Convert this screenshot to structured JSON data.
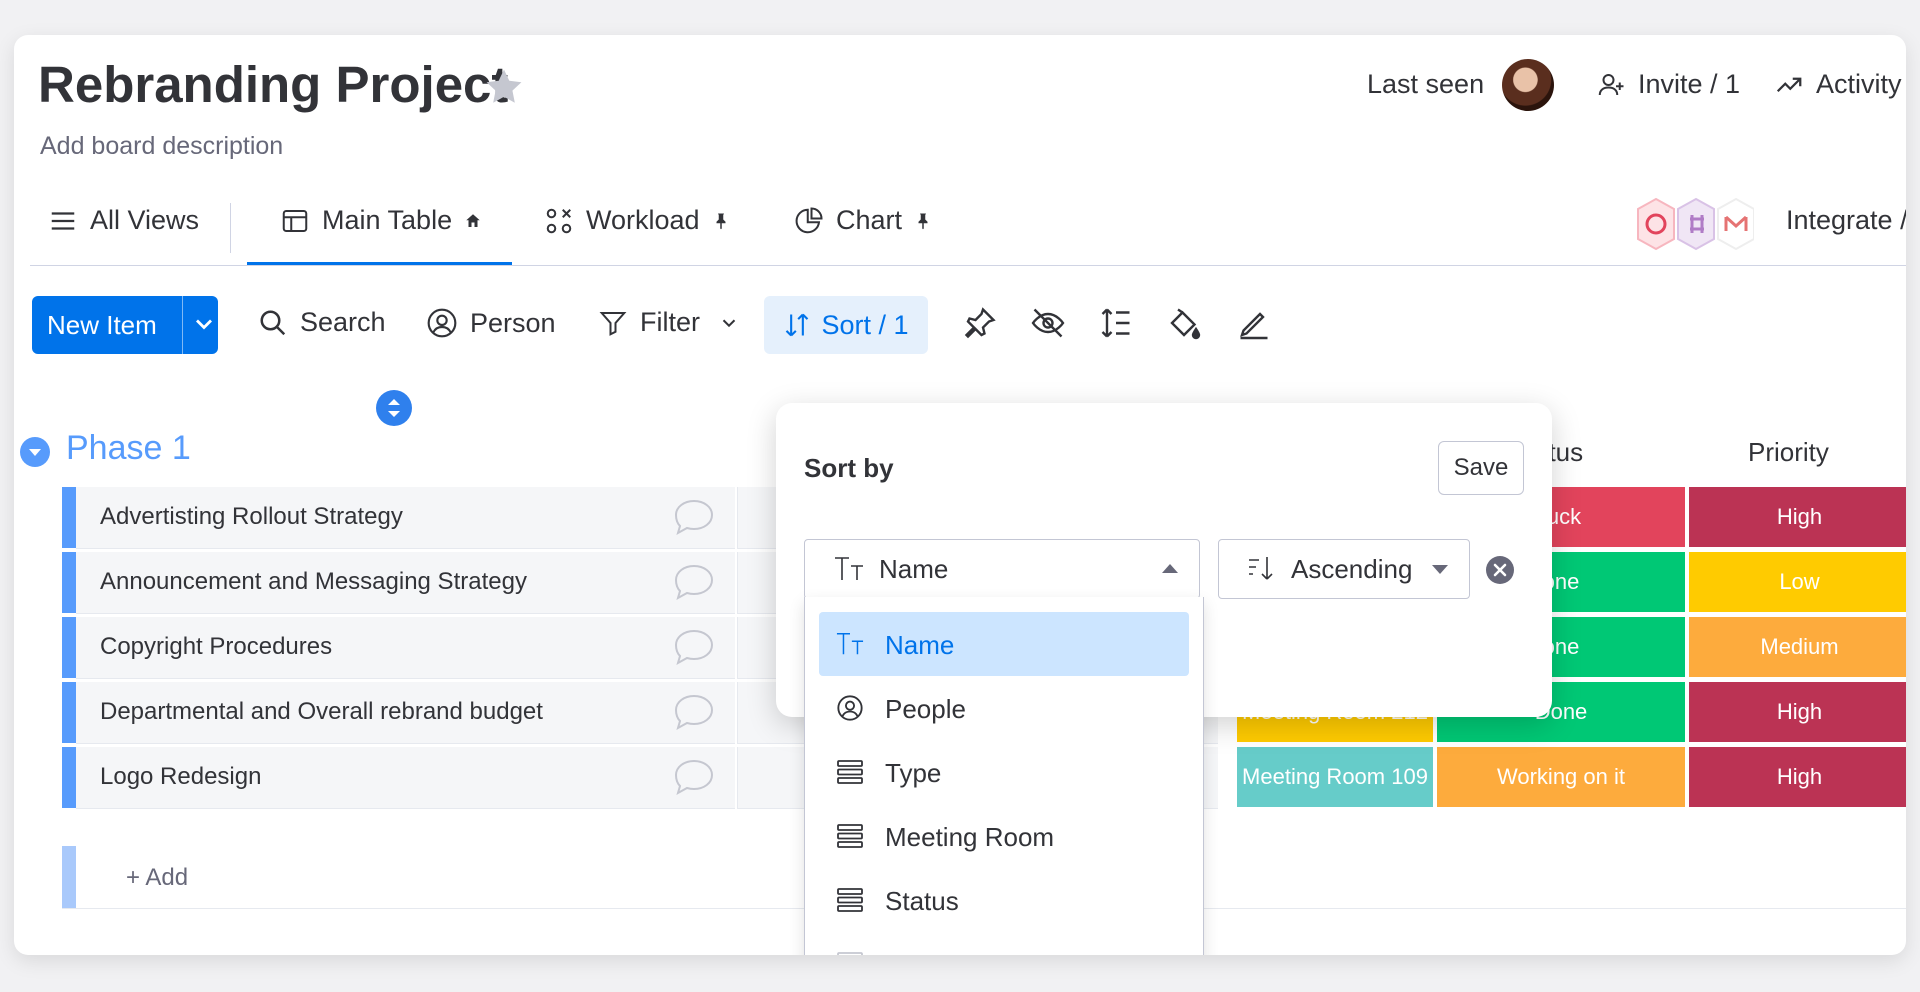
{
  "board": {
    "title": "Rebranding Project",
    "description": "Add board description"
  },
  "header": {
    "last_seen": "Last seen",
    "invite": "Invite / 1",
    "activity": "Activity"
  },
  "views": {
    "all_views": "All Views",
    "tabs": [
      {
        "label": "Main Table",
        "icon": "table-icon",
        "badge": "home-icon",
        "active": true
      },
      {
        "label": "Workload",
        "icon": "workload-icon",
        "badge": "pin-icon"
      },
      {
        "label": "Chart",
        "icon": "pie-chart-icon",
        "badge": "pin-icon"
      }
    ],
    "integrate": "Integrate /"
  },
  "toolbar": {
    "new_item": "New Item",
    "search": "Search",
    "person": "Person",
    "filter": "Filter",
    "sort": "Sort / 1",
    "icons": [
      "pin-icon",
      "hide-icon",
      "row-height-icon",
      "color-icon",
      "edit-icon"
    ]
  },
  "group": {
    "title": "Phase 1",
    "columns": {
      "status": "atus",
      "priority": "Priority"
    },
    "rows": [
      {
        "name": "Advertisting Rollout Strategy",
        "room": "",
        "status": "tuck",
        "priority": "High"
      },
      {
        "name": "Announcement and Messaging Strategy",
        "room": "",
        "status": "one",
        "priority": "Low"
      },
      {
        "name": "Copyright Procedures",
        "room": "",
        "status": "one",
        "priority": "Medium"
      },
      {
        "name": "Departmental and Overall rebrand budget",
        "room": "Meeting Room 212",
        "status": "Done",
        "priority": "High"
      },
      {
        "name": "Logo Redesign",
        "room": "Meeting Room 109",
        "status": "Working on it",
        "priority": "High"
      }
    ],
    "add_label": "+ Add"
  },
  "sort_popover": {
    "title": "Sort by",
    "save": "Save",
    "selected_column": "Name",
    "direction": "Ascending",
    "options": [
      {
        "label": "Name",
        "icon": "text-type-icon",
        "active": true
      },
      {
        "label": "People",
        "icon": "person-icon"
      },
      {
        "label": "Type",
        "icon": "list-column-icon"
      },
      {
        "label": "Meeting Room",
        "icon": "list-column-icon"
      },
      {
        "label": "Status",
        "icon": "list-column-icon"
      }
    ]
  },
  "colors": {
    "accent": "#0073ea",
    "group": "#579bfc",
    "stuck": "#e2445c",
    "done": "#00c875",
    "working": "#fdab3d",
    "high": "#bb3354",
    "low": "#ffcb00",
    "medium": "#fdab3d",
    "room212": "#ffcb00",
    "room109": "#66ccc9"
  }
}
